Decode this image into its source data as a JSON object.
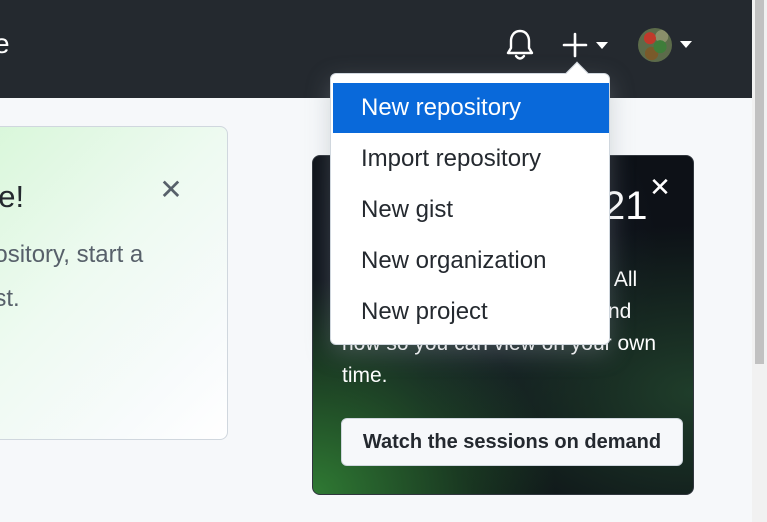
{
  "header": {
    "title_fragment": "e",
    "notifications_icon": "bell-icon",
    "create_icon": "plus-icon",
    "avatar_icon": "avatar"
  },
  "create_menu": {
    "items": [
      {
        "label": "New repository",
        "active": true
      },
      {
        "label": "Import repository",
        "active": false
      },
      {
        "label": "New gist",
        "active": false
      },
      {
        "label": "New organization",
        "active": false
      },
      {
        "label": "New project",
        "active": false
      }
    ]
  },
  "welcome_card": {
    "title": "de!",
    "body": "pository, start a\nest.",
    "close_icon": "close-icon"
  },
  "promo_card": {
    "year_fragment": "21",
    "text_line1": "s? All",
    "text_line2": "nd",
    "text_line3": "now so you can view on your own",
    "text_line4": "time.",
    "button_label": "Watch the sessions on demand",
    "close_icon": "close-icon"
  },
  "colors": {
    "header_bg": "#24292f",
    "accent": "#0969da",
    "page_bg": "#f6f8fa"
  }
}
